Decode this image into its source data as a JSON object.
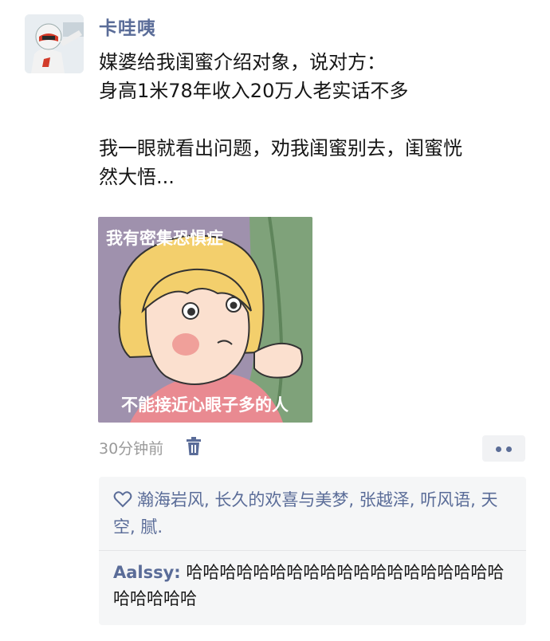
{
  "user": {
    "name": "卡哇咦"
  },
  "post": {
    "lines_1": [
      "媒婆给我闺蜜介绍对象，说对方：",
      "身高1米78年收入20万人老实话不多"
    ],
    "lines_2": [
      "我一眼就看出问题，劝我闺蜜别去，闺蜜恍",
      "然大悟..."
    ]
  },
  "image": {
    "caption_top": "我有密集恐惧症",
    "caption_bottom": "不能接近心眼子多的人"
  },
  "meta": {
    "time": "30分钟前"
  },
  "likes": {
    "names": [
      "瀚海岩风",
      "长久的欢喜与美梦",
      "张越泽",
      "听风语",
      "天空",
      "腻."
    ],
    "separator": ","
  },
  "comment": {
    "author": "Aalssy:",
    "text": " 哈哈哈哈哈哈哈哈哈哈哈哈哈哈哈哈哈哈哈哈哈哈哈哈"
  },
  "colors": {
    "link": "#5a6c98",
    "meta": "#9a9a9a",
    "panel": "#f5f6f7"
  }
}
